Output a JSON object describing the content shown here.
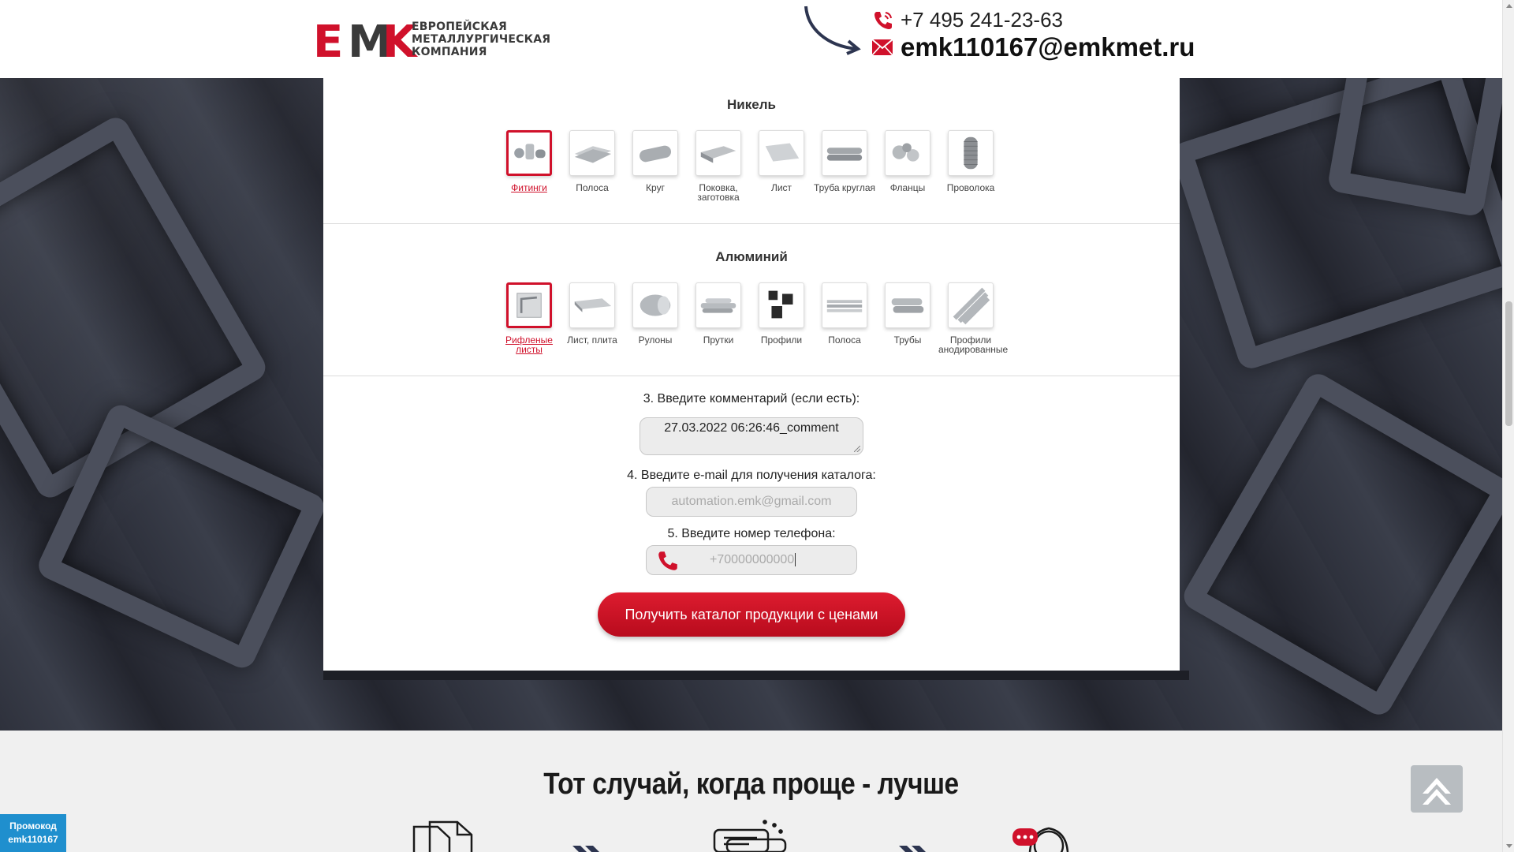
{
  "header": {
    "logo_letters": "EMK",
    "logo_lines": [
      "ЕВРОПЕЙСКАЯ",
      "МЕТАЛЛУРГИЧЕСКАЯ",
      "КОМПАНИЯ"
    ],
    "phone": "+7 495 241-23-63",
    "email": "emk110167@emkmet.ru",
    "icons": [
      "phone-icon",
      "mail-icon"
    ]
  },
  "nickel": {
    "title": "Никель",
    "items": [
      {
        "label": "Фитинги",
        "active": true
      },
      {
        "label": "Полоса"
      },
      {
        "label": "Круг"
      },
      {
        "label": "Поковка, заготовка"
      },
      {
        "label": "Лист"
      },
      {
        "label": "Труба круглая"
      },
      {
        "label": "Фланцы"
      },
      {
        "label": "Проволока"
      }
    ]
  },
  "aluminium": {
    "title": "Алюминий",
    "items": [
      {
        "label": "Рифленые листы",
        "active": true
      },
      {
        "label": "Лист, плита"
      },
      {
        "label": "Рулоны"
      },
      {
        "label": "Прутки"
      },
      {
        "label": "Профили"
      },
      {
        "label": "Полоса"
      },
      {
        "label": "Трубы"
      },
      {
        "label": "Профили анодированные"
      }
    ]
  },
  "form": {
    "comment_label": "3. Введите комментарий (если есть):",
    "comment_value": "27.03.2022 06:26:46_comment",
    "email_label": "4. Введите e-mail для получения каталога:",
    "email_placeholder": "automation.emk@gmail.com",
    "phone_label": "5. Введите номер телефона:",
    "phone_placeholder": "+70000000000",
    "submit_label": "Получить каталог продукции с ценами"
  },
  "lower": {
    "title": "Тот случай, когда проще - лучше"
  },
  "promo": {
    "line1": "Промокод",
    "line2": "emk110167"
  },
  "colors": {
    "accent": "#d0112b",
    "promo": "#1f8fce",
    "page_bg": "#2b2e38"
  }
}
